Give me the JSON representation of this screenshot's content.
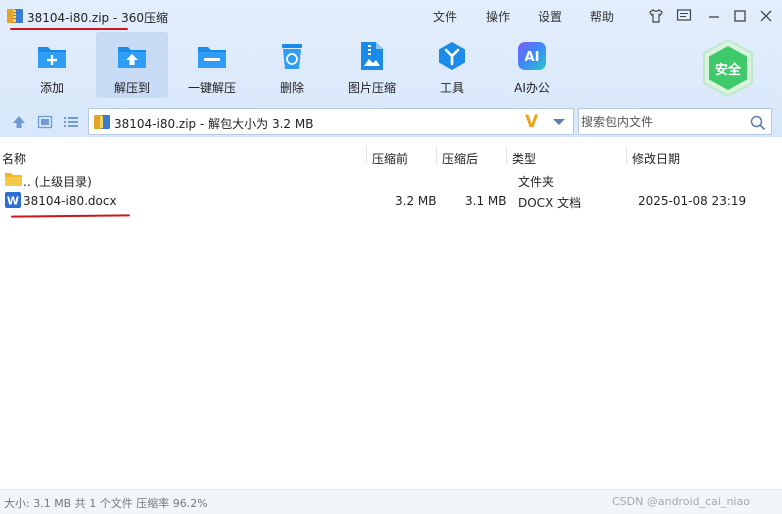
{
  "window": {
    "title": "38104-i80.zip - 360压缩",
    "menus": [
      "文件",
      "操作",
      "设置",
      "帮助"
    ]
  },
  "toolbar": {
    "items": [
      {
        "label": "添加",
        "icon": "add-icon"
      },
      {
        "label": "解压到",
        "icon": "extract-to-icon"
      },
      {
        "label": "一键解压",
        "icon": "one-click-extract-icon"
      },
      {
        "label": "删除",
        "icon": "delete-icon"
      },
      {
        "label": "图片压缩",
        "icon": "image-compress-icon"
      },
      {
        "label": "工具",
        "icon": "tools-icon"
      },
      {
        "label": "AI办公",
        "icon": "ai-office-icon"
      }
    ],
    "ai_text": "AI",
    "badge": "安全"
  },
  "address": {
    "path": "38104-i80.zip - 解包大小为 3.2 MB",
    "v_logo": "V"
  },
  "search": {
    "placeholder": "搜索包内文件"
  },
  "columns": {
    "name": "名称",
    "before": "压缩前",
    "after": "压缩后",
    "type": "类型",
    "modified": "修改日期"
  },
  "rows": [
    {
      "name": ".. (上级目录)",
      "before": "",
      "after": "",
      "type": "文件夹",
      "modified": ""
    },
    {
      "name": "38104-i80.docx",
      "before": "3.2 MB",
      "after": "3.1 MB",
      "type": "DOCX 文档",
      "modified": "2025-01-08 23:19",
      "icon_letter": "W"
    }
  ],
  "status": {
    "left": "大小: 3.1 MB 共 1 个文件 压缩率 96.2%",
    "watermark": "CSDN @android_cai_niao"
  },
  "colors": {
    "accent_blue": "#1a8be8",
    "annotation_red": "#d0151a",
    "badge_green": "#3ec96a"
  }
}
